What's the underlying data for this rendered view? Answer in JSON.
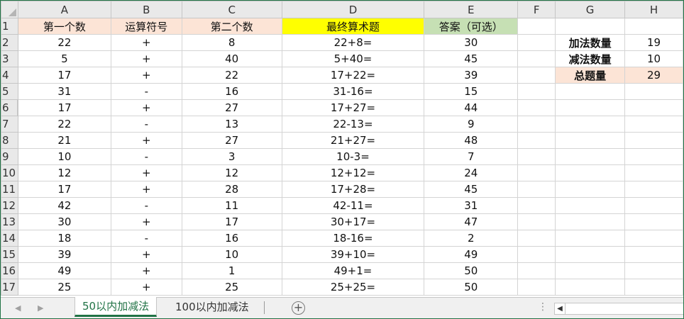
{
  "columns": [
    "A",
    "B",
    "C",
    "D",
    "E",
    "F",
    "G",
    "H"
  ],
  "rows": [
    {
      "num": "1",
      "A": "第一个数",
      "B": "运算符号",
      "C": "第二个数",
      "D": "最终算术题",
      "E": "答案（可选）",
      "F": "",
      "G": "",
      "H": ""
    },
    {
      "num": "2",
      "A": "22",
      "B": "+",
      "C": "8",
      "D": "22+8=",
      "E": "30",
      "F": "",
      "G": "加法数量",
      "H": "19"
    },
    {
      "num": "3",
      "A": "5",
      "B": "+",
      "C": "40",
      "D": "5+40=",
      "E": "45",
      "F": "",
      "G": "减法数量",
      "H": "10"
    },
    {
      "num": "4",
      "A": "17",
      "B": "+",
      "C": "22",
      "D": "17+22=",
      "E": "39",
      "F": "",
      "G": "总题量",
      "H": "29"
    },
    {
      "num": "5",
      "A": "31",
      "B": "-",
      "C": "16",
      "D": "31-16=",
      "E": "15",
      "F": "",
      "G": "",
      "H": ""
    },
    {
      "num": "6",
      "A": "17",
      "B": "+",
      "C": "27",
      "D": "17+27=",
      "E": "44",
      "F": "",
      "G": "",
      "H": ""
    },
    {
      "num": "7",
      "A": "22",
      "B": "-",
      "C": "13",
      "D": "22-13=",
      "E": "9",
      "F": "",
      "G": "",
      "H": ""
    },
    {
      "num": "8",
      "A": "21",
      "B": "+",
      "C": "27",
      "D": "21+27=",
      "E": "48",
      "F": "",
      "G": "",
      "H": ""
    },
    {
      "num": "9",
      "A": "10",
      "B": "-",
      "C": "3",
      "D": "10-3=",
      "E": "7",
      "F": "",
      "G": "",
      "H": ""
    },
    {
      "num": "10",
      "A": "12",
      "B": "+",
      "C": "12",
      "D": "12+12=",
      "E": "24",
      "F": "",
      "G": "",
      "H": ""
    },
    {
      "num": "11",
      "A": "17",
      "B": "+",
      "C": "28",
      "D": "17+28=",
      "E": "45",
      "F": "",
      "G": "",
      "H": ""
    },
    {
      "num": "12",
      "A": "42",
      "B": "-",
      "C": "11",
      "D": "42-11=",
      "E": "31",
      "F": "",
      "G": "",
      "H": ""
    },
    {
      "num": "13",
      "A": "30",
      "B": "+",
      "C": "17",
      "D": "30+17=",
      "E": "47",
      "F": "",
      "G": "",
      "H": ""
    },
    {
      "num": "14",
      "A": "18",
      "B": "-",
      "C": "16",
      "D": "18-16=",
      "E": "2",
      "F": "",
      "G": "",
      "H": ""
    },
    {
      "num": "15",
      "A": "39",
      "B": "+",
      "C": "10",
      "D": "39+10=",
      "E": "49",
      "F": "",
      "G": "",
      "H": ""
    },
    {
      "num": "16",
      "A": "49",
      "B": "+",
      "C": "1",
      "D": "49+1=",
      "E": "50",
      "F": "",
      "G": "",
      "H": ""
    },
    {
      "num": "17",
      "A": "25",
      "B": "+",
      "C": "25",
      "D": "25+25=",
      "E": "50",
      "F": "",
      "G": "",
      "H": ""
    }
  ],
  "sheet_tabs": [
    {
      "label": "50以内加减法",
      "active": true
    },
    {
      "label": "100以内加减法",
      "active": false
    }
  ],
  "colors": {
    "accent": "#217346",
    "header_pink": "#fce4d6",
    "header_yellow": "#ffff00",
    "header_green": "#c6e0b4"
  }
}
